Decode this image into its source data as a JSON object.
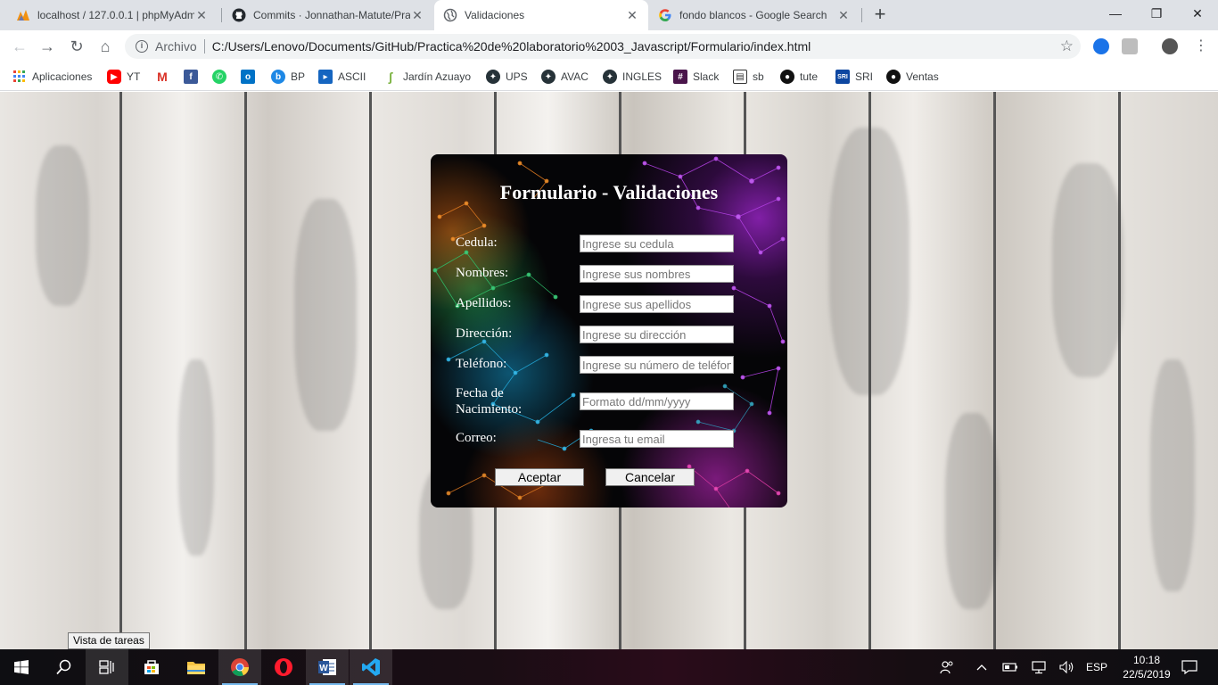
{
  "browser": {
    "tabs": [
      {
        "title": "localhost / 127.0.0.1 | phpMyAdm",
        "icon": "phpmyadmin-icon"
      },
      {
        "title": "Commits · Jonnathan-Matute/Pra",
        "icon": "github-icon"
      },
      {
        "title": "Validaciones",
        "icon": "globe-icon",
        "active": true
      },
      {
        "title": "fondo blancos - Google Search",
        "icon": "google-icon"
      }
    ],
    "new_tab": "+",
    "window_controls": {
      "minimize": "—",
      "maximize": "❐",
      "close": "✕"
    },
    "address": {
      "scheme_label": "Archivo",
      "url": "C:/Users/Lenovo/Documents/GitHub/Practica%20de%20laboratorio%2003_Javascript/Formulario/index.html"
    },
    "bookmarks": [
      {
        "label": "Aplicaciones",
        "icon": "apps-grid-icon",
        "color": "#4285f4"
      },
      {
        "label": "YT",
        "icon": "youtube-icon",
        "color": "#ff0000"
      },
      {
        "label": "",
        "icon": "gmail-icon",
        "color": "#d93025"
      },
      {
        "label": "",
        "icon": "facebook-icon",
        "color": "#3b5998"
      },
      {
        "label": "",
        "icon": "whatsapp-icon",
        "color": "#25d366"
      },
      {
        "label": "",
        "icon": "outlook-icon",
        "color": "#0072c6"
      },
      {
        "label": "BP",
        "icon": "bp-icon",
        "color": "#1e88e5"
      },
      {
        "label": "ASCII",
        "icon": "ascii-icon",
        "color": "#1565c0"
      },
      {
        "label": "Jardín Azuayo",
        "icon": "jardin-azuayo-icon",
        "color": "#7cb342"
      },
      {
        "label": "UPS",
        "icon": "ups-icon",
        "color": "#263238"
      },
      {
        "label": "AVAC",
        "icon": "avac-icon",
        "color": "#263238"
      },
      {
        "label": "INGLES",
        "icon": "ingles-icon",
        "color": "#263238"
      },
      {
        "label": "Slack",
        "icon": "slack-icon",
        "color": "#4a154b"
      },
      {
        "label": "sb",
        "icon": "sb-icon",
        "color": "#333333"
      },
      {
        "label": "tute",
        "icon": "github-icon",
        "color": "#111111"
      },
      {
        "label": "SRI",
        "icon": "sri-icon",
        "color": "#0d47a1"
      },
      {
        "label": "Ventas",
        "icon": "github-icon",
        "color": "#111111"
      }
    ]
  },
  "form": {
    "title": "Formulario - Validaciones",
    "fields": [
      {
        "label": "Cedula:",
        "placeholder": "Ingrese su cedula"
      },
      {
        "label": "Nombres:",
        "placeholder": "Ingrese sus nombres"
      },
      {
        "label": "Apellidos:",
        "placeholder": "Ingrese sus apellidos"
      },
      {
        "label": "Dirección:",
        "placeholder": "Ingrese su dirección"
      },
      {
        "label": "Teléfono:",
        "placeholder": "Ingrese su número de teléfono"
      },
      {
        "label": "Fecha de Nacimiento:",
        "placeholder": "Formato dd/mm/yyyy"
      },
      {
        "label": "Correo:",
        "placeholder": "Ingresa tu email"
      }
    ],
    "accept_label": "Aceptar",
    "cancel_label": "Cancelar"
  },
  "tooltip": "Vista de tareas",
  "taskbar": {
    "apps": [
      "start-icon",
      "search-icon",
      "task-view-icon",
      "store-icon",
      "file-explorer-icon",
      "chrome-icon",
      "opera-icon",
      "word-icon",
      "vscode-icon"
    ],
    "language": "ESP",
    "time": "10:18",
    "date": "22/5/2019"
  }
}
